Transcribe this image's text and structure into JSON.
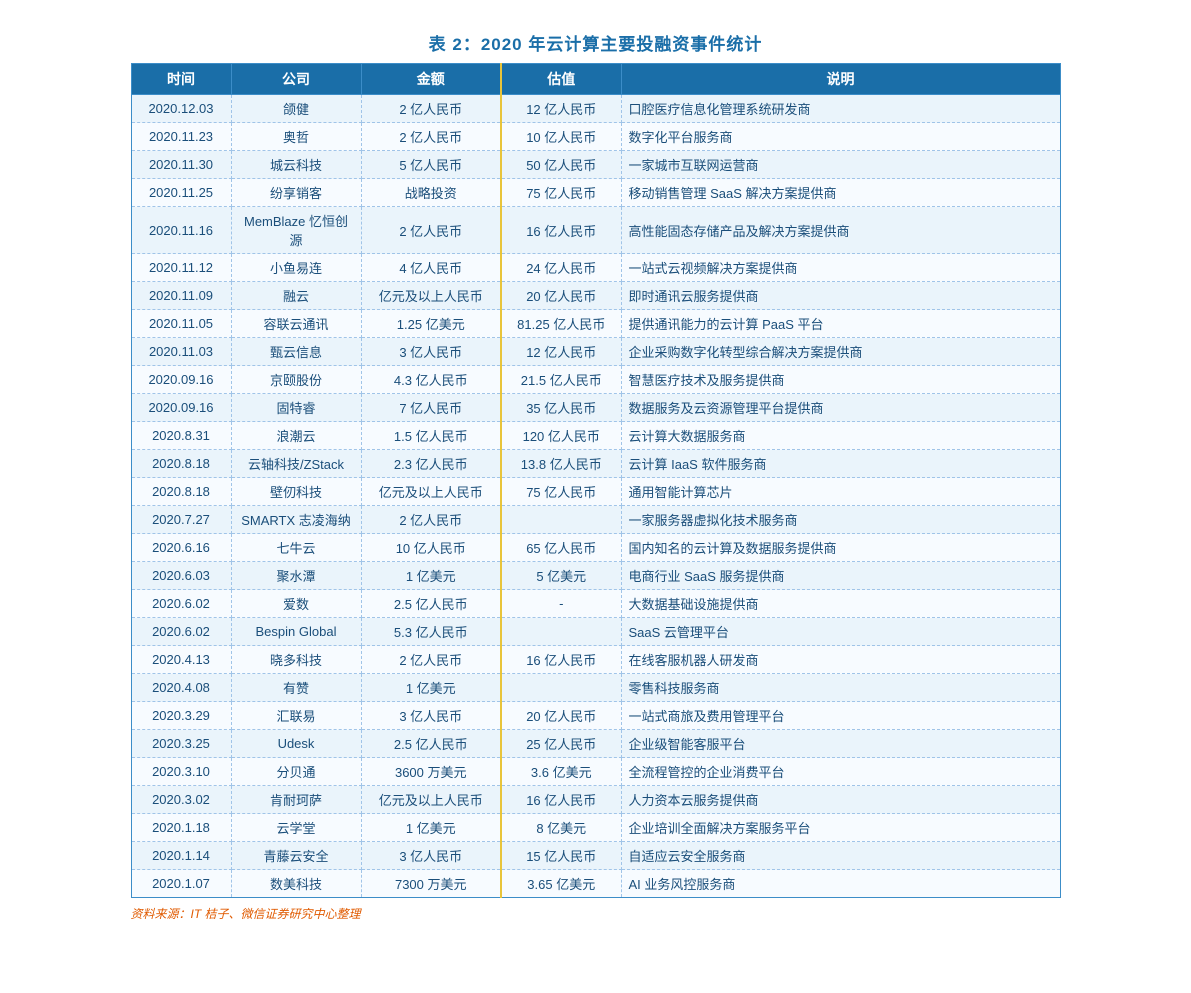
{
  "title": "表 2：2020 年云计算主要投融资事件统计",
  "columns": [
    "时间",
    "公司",
    "金额",
    "估值",
    "说明"
  ],
  "rows": [
    {
      "time": "2020.12.03",
      "company": "颌健",
      "amount": "2 亿人民币",
      "valuation": "12 亿人民币",
      "desc": "口腔医疗信息化管理系统研发商"
    },
    {
      "time": "2020.11.23",
      "company": "奥哲",
      "amount": "2 亿人民币",
      "valuation": "10 亿人民币",
      "desc": "数字化平台服务商"
    },
    {
      "time": "2020.11.30",
      "company": "城云科技",
      "amount": "5 亿人民币",
      "valuation": "50 亿人民币",
      "desc": "一家城市互联网运营商"
    },
    {
      "time": "2020.11.25",
      "company": "纷享销客",
      "amount": "战略投资",
      "valuation": "75 亿人民币",
      "desc": "移动销售管理 SaaS 解决方案提供商"
    },
    {
      "time": "2020.11.16",
      "company": "MemBlaze 忆恒创源",
      "amount": "2 亿人民币",
      "valuation": "16 亿人民币",
      "desc": "高性能固态存储产品及解决方案提供商"
    },
    {
      "time": "2020.11.12",
      "company": "小鱼易连",
      "amount": "4 亿人民币",
      "valuation": "24 亿人民币",
      "desc": "一站式云视频解决方案提供商"
    },
    {
      "time": "2020.11.09",
      "company": "融云",
      "amount": "亿元及以上人民币",
      "valuation": "20 亿人民币",
      "desc": "即时通讯云服务提供商"
    },
    {
      "time": "2020.11.05",
      "company": "容联云通讯",
      "amount": "1.25 亿美元",
      "valuation": "81.25 亿人民币",
      "desc": "提供通讯能力的云计算 PaaS 平台"
    },
    {
      "time": "2020.11.03",
      "company": "甄云信息",
      "amount": "3 亿人民币",
      "valuation": "12 亿人民币",
      "desc": "企业采购数字化转型综合解决方案提供商"
    },
    {
      "time": "2020.09.16",
      "company": "京颐股份",
      "amount": "4.3 亿人民币",
      "valuation": "21.5 亿人民币",
      "desc": "智慧医疗技术及服务提供商"
    },
    {
      "time": "2020.09.16",
      "company": "固特睿",
      "amount": "7 亿人民币",
      "valuation": "35 亿人民币",
      "desc": "数据服务及云资源管理平台提供商"
    },
    {
      "time": "2020.8.31",
      "company": "浪潮云",
      "amount": "1.5 亿人民币",
      "valuation": "120 亿人民币",
      "desc": "云计算大数据服务商"
    },
    {
      "time": "2020.8.18",
      "company": "云轴科技/ZStack",
      "amount": "2.3 亿人民币",
      "valuation": "13.8 亿人民币",
      "desc": "云计算 IaaS 软件服务商"
    },
    {
      "time": "2020.8.18",
      "company": "壁仞科技",
      "amount": "亿元及以上人民币",
      "valuation": "75 亿人民币",
      "desc": "通用智能计算芯片"
    },
    {
      "time": "2020.7.27",
      "company": "SMARTX 志凌海纳",
      "amount": "2 亿人民币",
      "valuation": "",
      "desc": "一家服务器虚拟化技术服务商"
    },
    {
      "time": "2020.6.16",
      "company": "七牛云",
      "amount": "10 亿人民币",
      "valuation": "65 亿人民币",
      "desc": "国内知名的云计算及数据服务提供商"
    },
    {
      "time": "2020.6.03",
      "company": "聚水潭",
      "amount": "1 亿美元",
      "valuation": "5 亿美元",
      "desc": "电商行业 SaaS 服务提供商"
    },
    {
      "time": "2020.6.02",
      "company": "爱数",
      "amount": "2.5 亿人民币",
      "valuation": "-",
      "desc": "大数据基础设施提供商"
    },
    {
      "time": "2020.6.02",
      "company": "Bespin Global",
      "amount": "5.3 亿人民币",
      "valuation": "",
      "desc": "SaaS 云管理平台"
    },
    {
      "time": "2020.4.13",
      "company": "晓多科技",
      "amount": "2 亿人民币",
      "valuation": "16 亿人民币",
      "desc": "在线客服机器人研发商"
    },
    {
      "time": "2020.4.08",
      "company": "有赞",
      "amount": "1 亿美元",
      "valuation": "",
      "desc": "零售科技服务商"
    },
    {
      "time": "2020.3.29",
      "company": "汇联易",
      "amount": "3 亿人民币",
      "valuation": "20 亿人民币",
      "desc": "一站式商旅及费用管理平台"
    },
    {
      "time": "2020.3.25",
      "company": "Udesk",
      "amount": "2.5 亿人民币",
      "valuation": "25 亿人民币",
      "desc": "企业级智能客服平台"
    },
    {
      "time": "2020.3.10",
      "company": "分贝通",
      "amount": "3600 万美元",
      "valuation": "3.6 亿美元",
      "desc": "全流程管控的企业消费平台"
    },
    {
      "time": "2020.3.02",
      "company": "肯耐珂萨",
      "amount": "亿元及以上人民币",
      "valuation": "16 亿人民币",
      "desc": "人力资本云服务提供商"
    },
    {
      "time": "2020.1.18",
      "company": "云学堂",
      "amount": "1 亿美元",
      "valuation": "8 亿美元",
      "desc": "企业培训全面解决方案服务平台"
    },
    {
      "time": "2020.1.14",
      "company": "青藤云安全",
      "amount": "3 亿人民币",
      "valuation": "15 亿人民币",
      "desc": "自适应云安全服务商"
    },
    {
      "time": "2020.1.07",
      "company": "数美科技",
      "amount": "7300 万美元",
      "valuation": "3.65 亿美元",
      "desc": "AI 业务风控服务商"
    }
  ],
  "source": "资料来源：IT 桔子、微信证券研究中心整理"
}
